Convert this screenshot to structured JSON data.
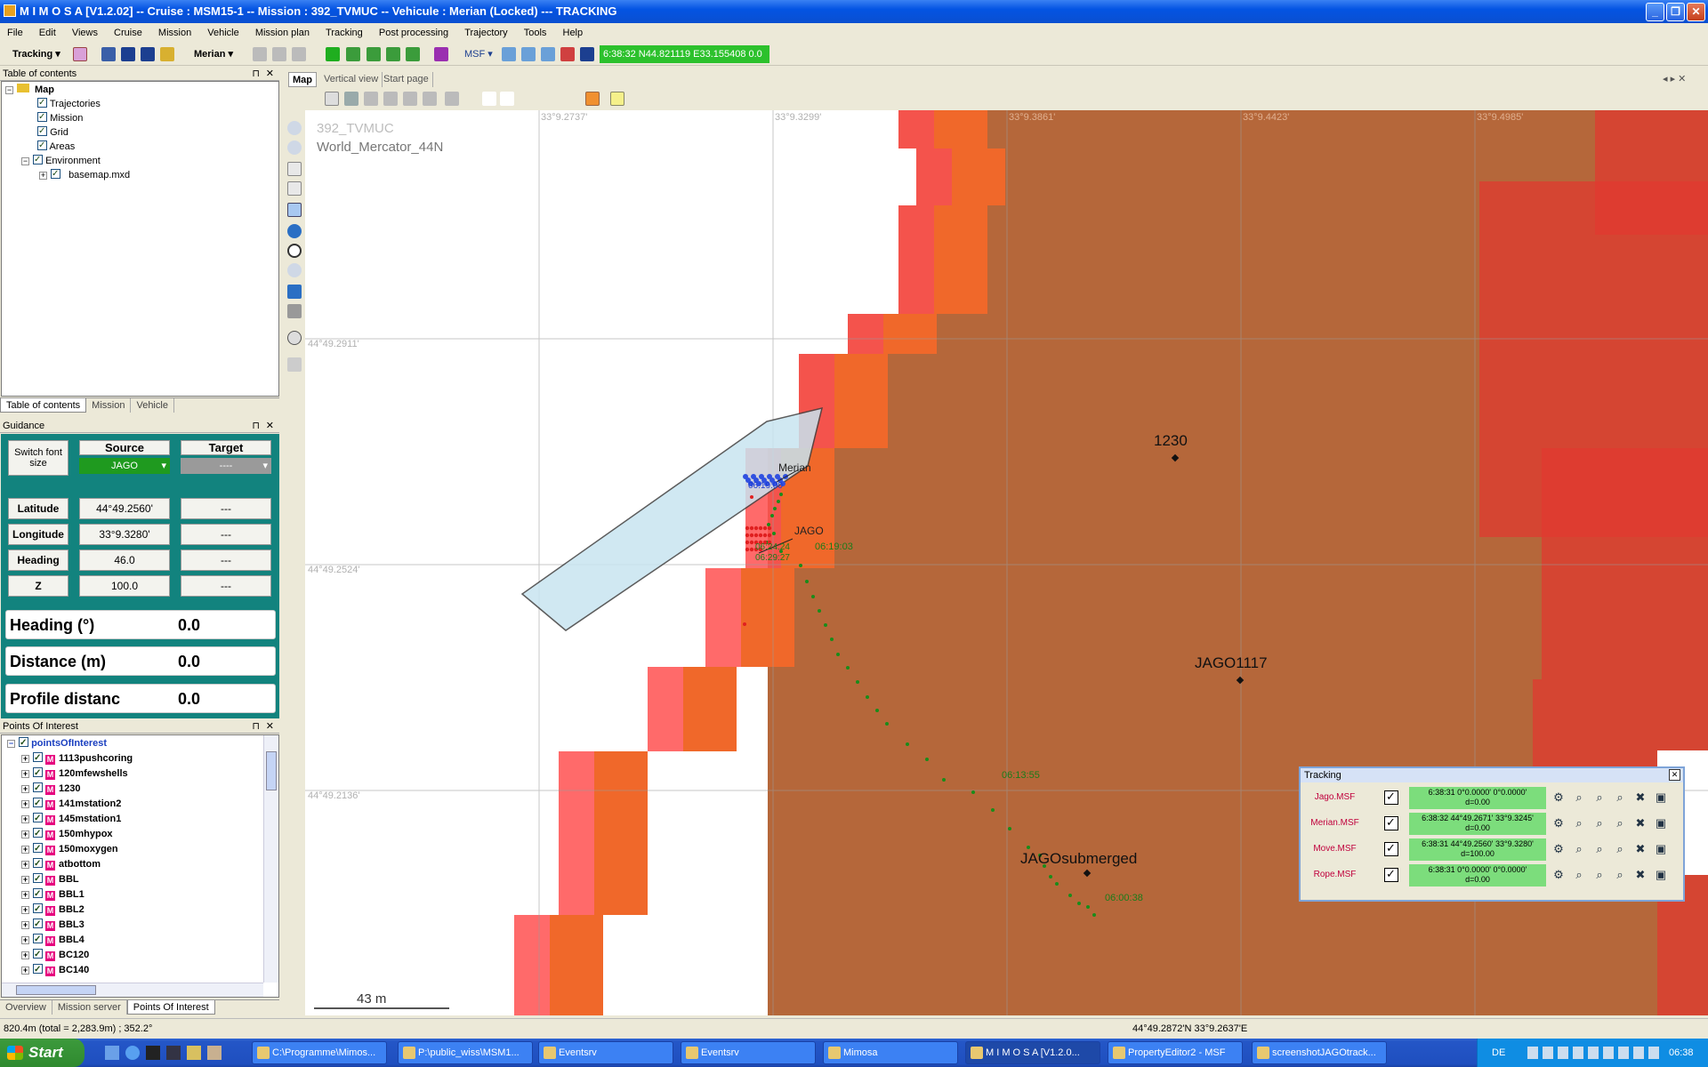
{
  "window": {
    "title": "M I M O S A  [V1.2.02] -- Cruise : MSM15-1 -- Mission : 392_TVMUC -- Vehicule : Merian (Locked) --- TRACKING",
    "btn_minimize": "_",
    "btn_maximize": "❐",
    "btn_close": "✕"
  },
  "menu": [
    "File",
    "Edit",
    "Views",
    "Cruise",
    "Mission",
    "Vehicle",
    "Mission plan",
    "Tracking",
    "Post processing",
    "Trajectory",
    "Tools",
    "Help"
  ],
  "toolbar": {
    "mode_label": "Tracking",
    "vehicle_label": "Merian",
    "msf_label": "MSF",
    "position_readout": "6:38:32 N44.821119 E33.155408 0.0"
  },
  "toc": {
    "header": "Table of contents",
    "pin": "⊓",
    "close": "✕",
    "items": {
      "map": "Map",
      "trajectories": "Trajectories",
      "mission": "Mission",
      "grid": "Grid",
      "areas": "Areas",
      "environment": "Environment",
      "basemap": "basemap.mxd"
    },
    "tabs": [
      "Table of contents",
      "Mission",
      "Vehicle"
    ]
  },
  "guidance": {
    "header": "Guidance",
    "switch_font": "Switch font size",
    "source_label": "Source",
    "target_label": "Target",
    "source_value": "JAGO",
    "target_value": "----",
    "rows": [
      {
        "label": "Latitude",
        "source": "44°49.2560'",
        "target": "---"
      },
      {
        "label": "Longitude",
        "source": "33°9.3280'",
        "target": "---"
      },
      {
        "label": "Heading",
        "source": "46.0",
        "target": "---"
      },
      {
        "label": "Z",
        "source": "100.0",
        "target": "---"
      }
    ],
    "big": [
      {
        "label": "Heading (°)",
        "value": "0.0"
      },
      {
        "label": "Distance (m)",
        "value": "0.0"
      },
      {
        "label": "Profile distanc",
        "value": "0.0"
      }
    ]
  },
  "poi": {
    "header": "Points Of Interest",
    "root": "pointsOfInterest",
    "items": [
      "1113pushcoring",
      "120mfewshells",
      "1230",
      "141mstation2",
      "145mstation1",
      "150mhypox",
      "150moxygen",
      "atbottom",
      "BBL",
      "BBL1",
      "BBL2",
      "BBL3",
      "BBL4",
      "BC120",
      "BC140"
    ],
    "tabs": [
      "Overview",
      "Mission server",
      "Points Of Interest"
    ]
  },
  "doc_tabs": [
    "Map",
    "Vertical view",
    "Start page"
  ],
  "map": {
    "mission_name": "392_TVMUC",
    "projection": "World_Mercator_44N",
    "lon_labels": [
      "33°9.2737'",
      "33°9.3299'",
      "33°9.3861'",
      "33°9.4423'",
      "33°9.4985'"
    ],
    "lat_labels": [
      "44°49.2911'",
      "44°49.2524'",
      "44°49.2136'"
    ],
    "poi_labels": [
      "1230",
      "JAGO1117",
      "JAGOsubmerged"
    ],
    "vessel_label": "Merian",
    "vessel_time": "06:19:00",
    "jago_label": "JAGO",
    "time_labels": [
      "06:19:03",
      "06:13:55",
      "06:00:38"
    ],
    "cluster_times": [
      "06:24:24",
      "06:29:27"
    ],
    "scale_text": "43 m",
    "colors": {
      "deep": "#b5673a",
      "mid": "#f0682a",
      "shallow": "#ff5050",
      "track": "#1a8c1a"
    }
  },
  "tracking": {
    "header": "Tracking",
    "close": "✕",
    "rows": [
      {
        "name": "Jago.MSF",
        "line1": "6:38:31 0°0.0000' 0°0.0000'",
        "line2": "d=0.00"
      },
      {
        "name": "Merian.MSF",
        "line1": "6:38:32 44°49.2671' 33°9.3245'",
        "line2": "d=0.00"
      },
      {
        "name": "Move.MSF",
        "line1": "6:38:31 44°49.2560' 33°9.3280'",
        "line2": "d=100.00"
      },
      {
        "name": "Rope.MSF",
        "line1": "6:38:31 0°0.0000' 0°0.0000'",
        "line2": "d=0.00"
      }
    ]
  },
  "status": {
    "left": "820.4m (total = 2,283.9m) ; 352.2°",
    "right": "44°49.2872'N  33°9.2637'E"
  },
  "taskbar": {
    "start": "Start",
    "tasks": [
      "C:\\Programme\\Mimos...",
      "P:\\public_wiss\\MSM1...",
      "Eventsrv",
      "Eventsrv",
      "Mimosa",
      "M I M O S A  [V1.2.0...",
      "PropertyEditor2 - MSF",
      "screenshotJAGOtrack..."
    ],
    "lang": "DE",
    "clock": "06:38"
  }
}
